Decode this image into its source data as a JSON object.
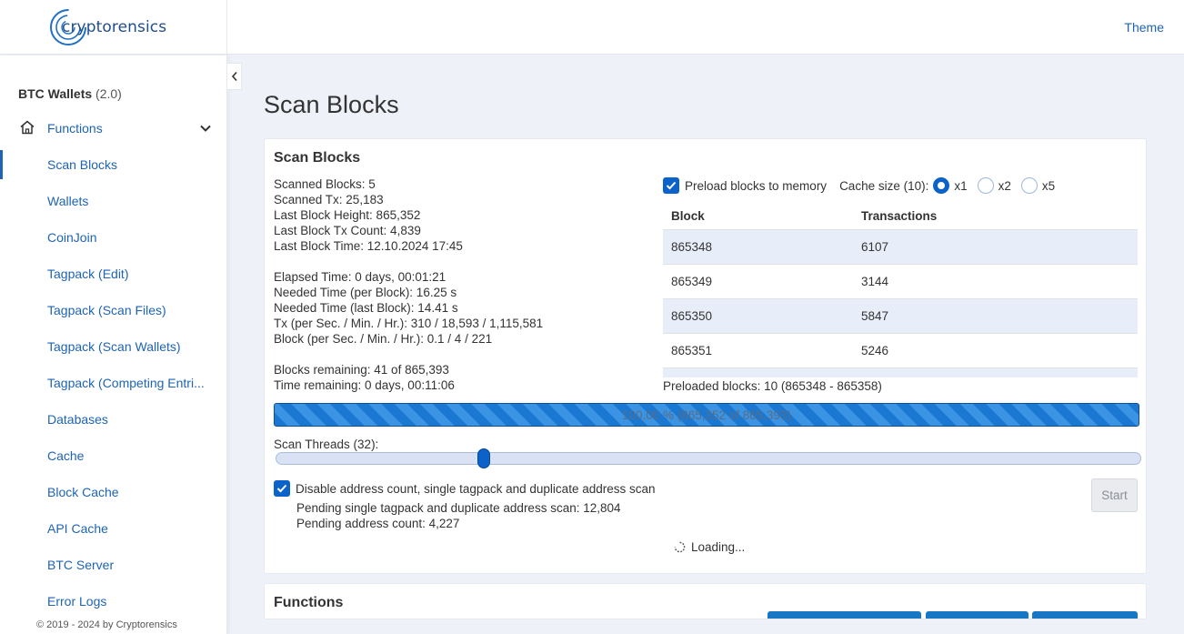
{
  "header": {
    "logo_text": "cryptorensics",
    "theme_label": "Theme"
  },
  "sidebar": {
    "app_name": "BTC Wallets",
    "app_version": "(2.0)",
    "section_label": "Functions",
    "items": [
      {
        "label": "Scan Blocks"
      },
      {
        "label": "Wallets"
      },
      {
        "label": "CoinJoin"
      },
      {
        "label": "Tagpack (Edit)"
      },
      {
        "label": "Tagpack (Scan Files)"
      },
      {
        "label": "Tagpack (Scan Wallets)"
      },
      {
        "label": "Tagpack (Competing Entri..."
      },
      {
        "label": "Databases"
      },
      {
        "label": "Cache"
      },
      {
        "label": "Block Cache"
      },
      {
        "label": "API Cache"
      },
      {
        "label": "BTC Server"
      },
      {
        "label": "Error Logs"
      }
    ],
    "footer": "© 2019 - 2024 by Cryptorensics"
  },
  "page": {
    "title": "Scan Blocks"
  },
  "scan_card": {
    "title": "Scan Blocks",
    "stats": [
      "Scanned Blocks: 5",
      "Scanned Tx: 25,183",
      "Last Block Height: 865,352",
      "Last Block Tx Count: 4,839",
      "Last Block Time: 12.10.2024 17:45"
    ],
    "timing": [
      "Elapsed Time: 0 days, 00:01:21",
      "Needed Time (per Block): 16.25 s",
      "Needed Time (last Block): 14.41 s",
      "Tx (per Sec. / Min. / Hr.): 310 / 18,593 / 1,115,581",
      "Block (per Sec. / Min. / Hr.): 0.1 / 4 / 221"
    ],
    "remaining": [
      "Blocks remaining: 41 of 865,393",
      "Time remaining: 0 days, 00:11:06"
    ],
    "preload_label": "Preload blocks to memory",
    "cache_size_label": "Cache size (10):",
    "cache_options": [
      "x1",
      "x2",
      "x5"
    ],
    "cache_selected": "x1",
    "table": {
      "headers": [
        "Block",
        "Transactions"
      ],
      "rows": [
        [
          "865348",
          "6107"
        ],
        [
          "865349",
          "3144"
        ],
        [
          "865350",
          "5847"
        ],
        [
          "865351",
          "5246"
        ]
      ]
    },
    "preloaded_text": "Preloaded blocks: 10 (865348 - 865358)",
    "progress": {
      "text": "100.00 % (865,352 of 865,393)",
      "percent": 100
    },
    "threads_label": "Scan Threads (32):",
    "threads_value_fraction": 0.24,
    "disable_label": "Disable address count, single tagpack and duplicate address scan",
    "pending": [
      "Pending single tagpack and duplicate address scan: 12,804",
      "Pending address count: 4,227"
    ],
    "start_label": "Start",
    "loading_label": "Loading..."
  },
  "functions_card": {
    "title": "Functions"
  },
  "colors": {
    "accent": "#1e64b4",
    "primary": "#0b63c9",
    "background": "#eef1f8"
  }
}
